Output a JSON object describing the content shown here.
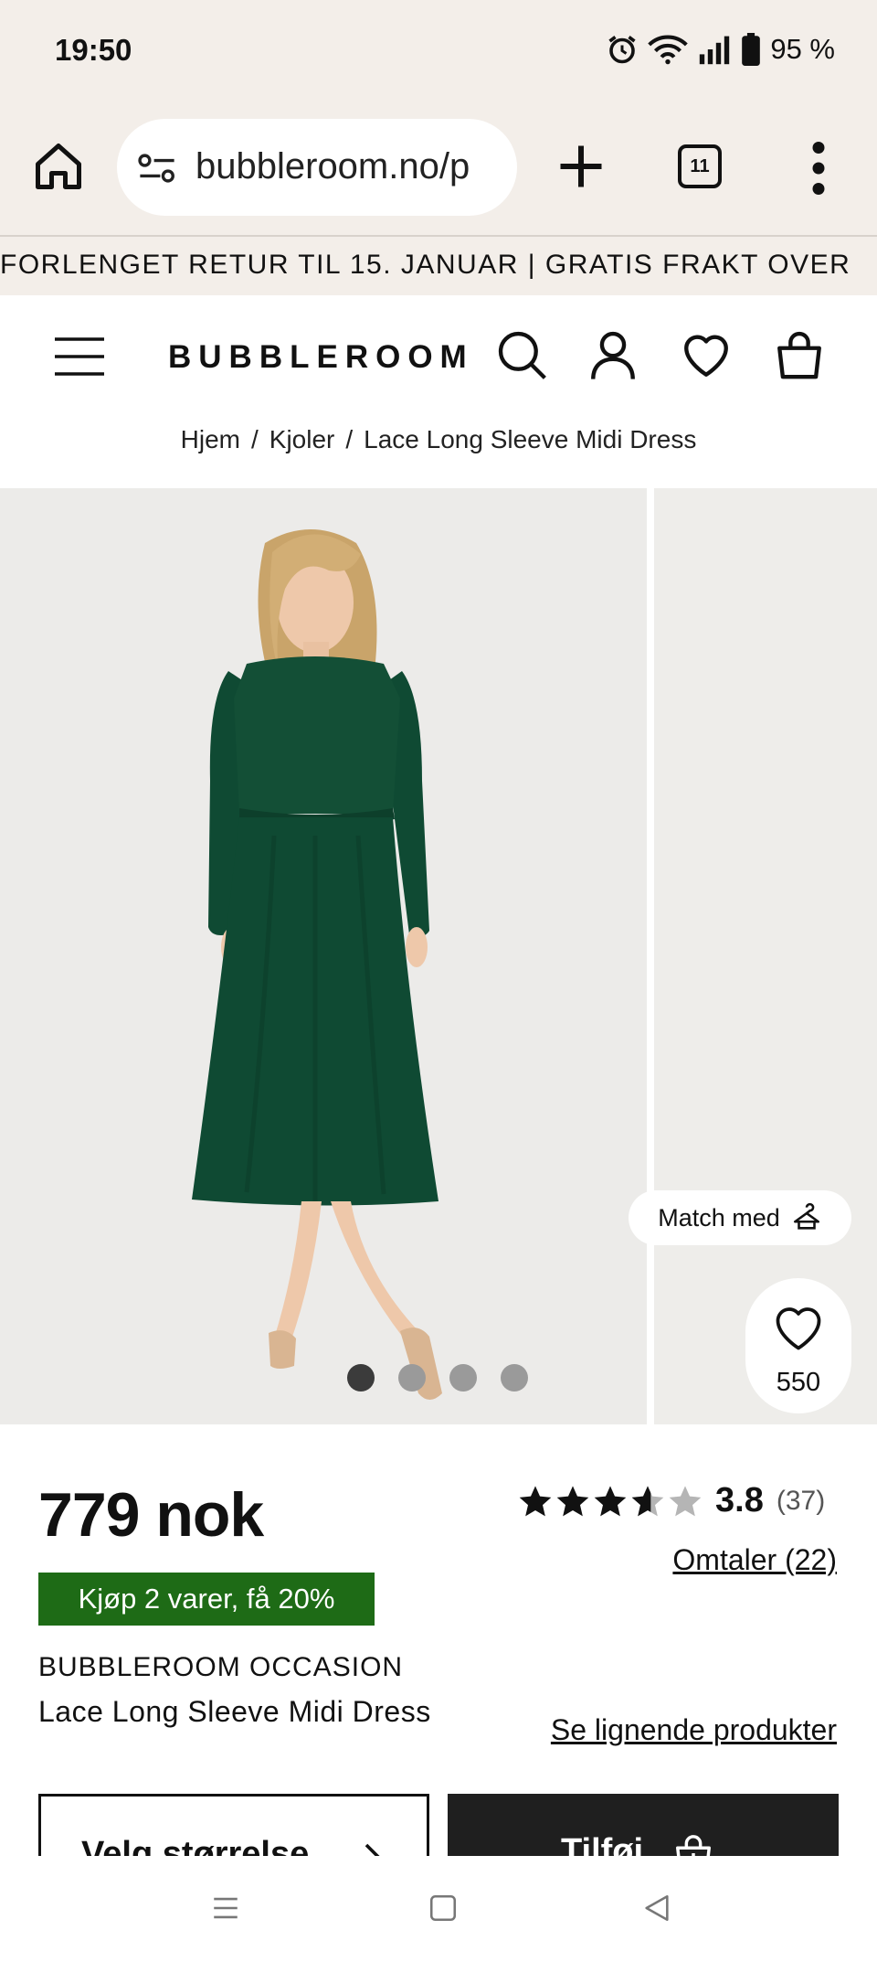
{
  "status_bar": {
    "time": "19:50",
    "battery": "95 %",
    "icons": [
      "alarm-icon",
      "wifi-icon",
      "signal-icon",
      "battery-icon"
    ]
  },
  "browser": {
    "url": "bubbleroom.no/p",
    "tab_count": "11",
    "icons": [
      "home-icon",
      "site-settings-icon",
      "new-tab-icon",
      "tabs-icon",
      "more-menu-icon"
    ]
  },
  "promo": {
    "text": "FORLENGET RETUR TIL 15. JANUAR | GRATIS FRAKT OVER"
  },
  "header": {
    "logo": "BUBBLEROOM",
    "icons": [
      "menu-icon",
      "search-icon",
      "account-icon",
      "wishlist-icon",
      "cart-icon"
    ]
  },
  "breadcrumb": {
    "items": [
      "Hjem",
      "Kjoler",
      "Lace Long Sleeve Midi Dress"
    ],
    "separator": "/"
  },
  "gallery": {
    "match_label": "Match med",
    "favorites_count": "550",
    "slide_count": 4,
    "active_slide": 1
  },
  "product": {
    "price": "779 nok",
    "deal_badge": "Kjøp 2 varer, få 20%",
    "brand": "BUBBLEROOM OCCASION",
    "name": "Lace Long Sleeve Midi Dress",
    "rating_value": "3.8",
    "rating_count": "(37)",
    "rating_stars": 3.8,
    "reviews_link": "Omtaler (22)",
    "similar_link": "Se lignende produkter"
  },
  "actions": {
    "size_button": "Velg størrelse",
    "add_button": "Tilføj"
  },
  "colors": {
    "browser_bg": "#f3eee9",
    "deal_green": "#1e6b16",
    "dress_green": "#0f4a33",
    "button_dark": "#1f1f1f"
  }
}
